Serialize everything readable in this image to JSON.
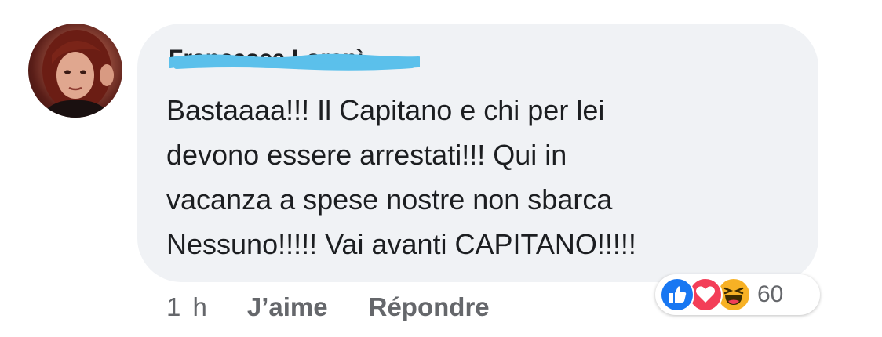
{
  "comment": {
    "author": "Francesca Lorenì",
    "message": "Bastaaaa!!! Il Capitano e chi per lei\ndevono essere arrestati!!! Qui in\nvacanza a spese nostre non sbarca\nNessuno!!!!! Vai avanti CAPITANO!!!!!",
    "time": "1 h",
    "like_label": "J’aime",
    "reply_label": "Répondre",
    "reactions": {
      "icons": [
        "like-icon",
        "love-icon",
        "haha-icon"
      ],
      "count": "60"
    }
  },
  "colors": {
    "bubble": "#f0f2f5",
    "text": "#1c1e21",
    "meta": "#65676b",
    "redaction": "#5bc0eb",
    "like": "#1877f2",
    "love": "#f33e58",
    "haha": "#f7b125"
  }
}
